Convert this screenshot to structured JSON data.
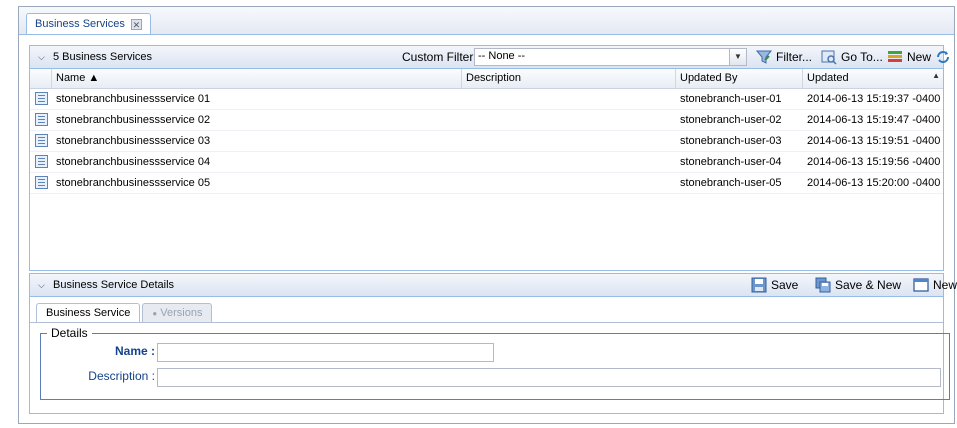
{
  "tab": {
    "title": "Business Services"
  },
  "grid": {
    "count_title": "5 Business Services",
    "custom_filter_label": "Custom Filter",
    "custom_filter_value": "-- None --",
    "filter_label": "Filter...",
    "goto_label": "Go To...",
    "new_label": "New",
    "columns": {
      "name": "Name",
      "description": "Description",
      "updated_by": "Updated By",
      "updated": "Updated"
    },
    "rows": [
      {
        "name": "stonebranchbusinessservice 01",
        "description": "",
        "updated_by": "stonebranch-user-01",
        "updated": "2014-06-13 15:19:37 -0400"
      },
      {
        "name": "stonebranchbusinessservice 02",
        "description": "",
        "updated_by": "stonebranch-user-02",
        "updated": "2014-06-13 15:19:47 -0400"
      },
      {
        "name": "stonebranchbusinessservice 03",
        "description": "",
        "updated_by": "stonebranch-user-03",
        "updated": "2014-06-13 15:19:51 -0400"
      },
      {
        "name": "stonebranchbusinessservice 04",
        "description": "",
        "updated_by": "stonebranch-user-04",
        "updated": "2014-06-13 15:19:56 -0400"
      },
      {
        "name": "stonebranchbusinessservice 05",
        "description": "",
        "updated_by": "stonebranch-user-05",
        "updated": "2014-06-13 15:20:00 -0400"
      }
    ]
  },
  "details": {
    "title": "Business Service Details",
    "save_label": "Save",
    "save_new_label": "Save & New",
    "new_label": "New",
    "tabs": [
      "Business Service",
      "Versions"
    ],
    "fieldset_legend": "Details",
    "name_label": "Name :",
    "name_value": "",
    "description_label": "Description :",
    "description_value": ""
  }
}
